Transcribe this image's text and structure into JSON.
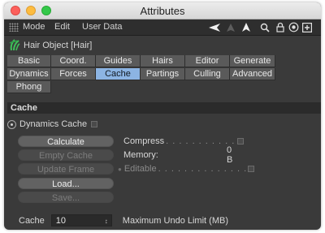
{
  "window": {
    "title": "Attributes"
  },
  "menu": {
    "mode": "Mode",
    "edit": "Edit",
    "user_data": "User Data"
  },
  "object": {
    "label": "Hair Object [Hair]"
  },
  "tabs": [
    {
      "label": "Basic",
      "active": false
    },
    {
      "label": "Coord.",
      "active": false
    },
    {
      "label": "Guides",
      "active": false
    },
    {
      "label": "Hairs",
      "active": false
    },
    {
      "label": "Editor",
      "active": false
    },
    {
      "label": "Generate",
      "active": false
    },
    {
      "label": "Dynamics",
      "active": false
    },
    {
      "label": "Forces",
      "active": false
    },
    {
      "label": "Cache",
      "active": true
    },
    {
      "label": "Partings",
      "active": false
    },
    {
      "label": "Culling",
      "active": false
    },
    {
      "label": "Advanced",
      "active": false
    },
    {
      "label": "Phong",
      "active": false
    }
  ],
  "section": {
    "title": "Cache"
  },
  "dynamics_cache": {
    "label": "Dynamics Cache"
  },
  "buttons": {
    "calculate": "Calculate",
    "empty_cache": "Empty Cache",
    "update_frame": "Update Frame",
    "load": "Load...",
    "save": "Save..."
  },
  "props": {
    "compress": "Compress",
    "compress_dots": ". . . . . . . . . . .",
    "memory": "Memory:",
    "memory_value": "0 B",
    "editable": "Editable",
    "editable_dots": ". . . . . . . . . . . . . ."
  },
  "cache_field": {
    "label": "Cache",
    "value": "10",
    "hint": "Maximum Undo Limit (MB)"
  },
  "colors": {
    "active_tab": "#8cb4e3",
    "panel": "#3a3a3a"
  }
}
